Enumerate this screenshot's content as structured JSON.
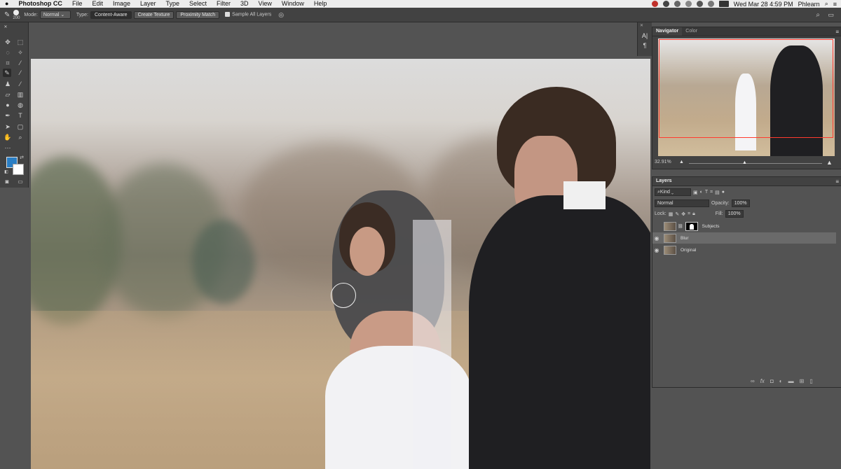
{
  "menubar": {
    "apple": "",
    "app_name": "Photoshop CC",
    "menus": [
      "File",
      "Edit",
      "Image",
      "Layer",
      "Type",
      "Select",
      "Filter",
      "3D",
      "View",
      "Window",
      "Help"
    ],
    "datetime": "Wed Mar 28  4:59 PM",
    "user": "Phlearn"
  },
  "options": {
    "brush_size": "200",
    "mode_label": "Mode:",
    "mode_value": "Normal",
    "type_label": "Type:",
    "type_buttons": [
      "Content-Aware",
      "Create Texture",
      "Proximity Match"
    ],
    "sample_all_layers": "Sample All Layers"
  },
  "side_strip": {
    "char_icon": "A|",
    "para_icon": "¶"
  },
  "navigator": {
    "tabs": [
      "Navigator",
      "Color"
    ],
    "zoom": "32.91%"
  },
  "layers": {
    "title": "Layers",
    "filter_kind": "Kind",
    "blend_mode": "Normal",
    "opacity_label": "Opacity:",
    "opacity_value": "100%",
    "lock_label": "Lock:",
    "fill_label": "Fill:",
    "fill_value": "100%",
    "items": [
      {
        "name": "Subjects",
        "visible": false,
        "selected": false,
        "has_mask": true
      },
      {
        "name": "Blur",
        "visible": true,
        "selected": true,
        "has_mask": false
      },
      {
        "name": "Original",
        "visible": true,
        "selected": false,
        "has_mask": false
      }
    ],
    "footer_icons": [
      "link-icon",
      "fx-icon",
      "mask-icon",
      "adjustment-icon",
      "folder-icon",
      "new-layer-icon",
      "trash-icon"
    ]
  },
  "colors": {
    "foreground": "#2a7ec4",
    "background": "#ffffff",
    "nav_frame": "#ff3b2f"
  }
}
